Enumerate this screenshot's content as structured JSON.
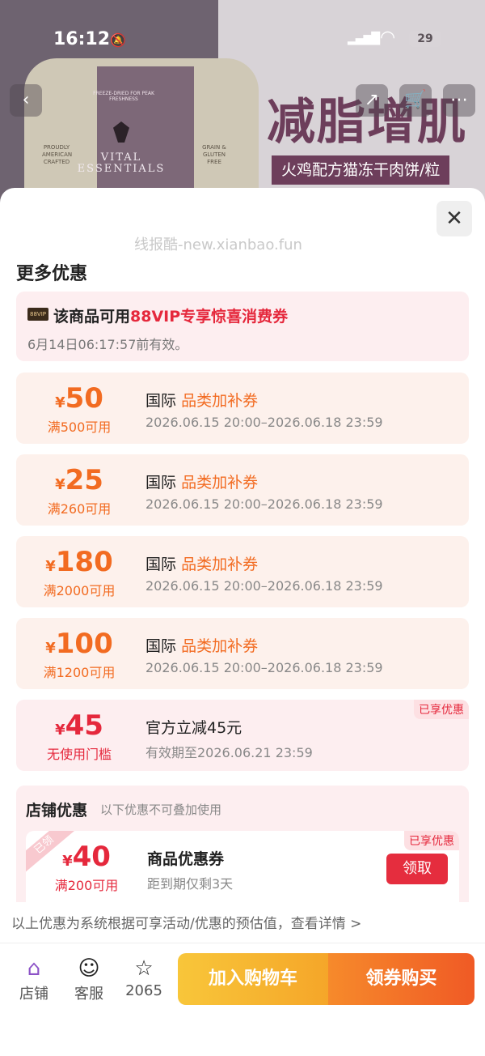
{
  "status": {
    "time": "16:12",
    "battery": "29"
  },
  "product_bg": {
    "promo_title": "减脂增肌",
    "promo_sub": "火鸡配方猫冻干肉饼/粒",
    "brand": "VITAL ESSENTIALS",
    "tagline": "FREEZE-DRIED FOR PEAK FRESHNESS",
    "badge_left": "PROUDLY AMERICAN CRAFTED",
    "badge_right": "GRAIN & GLUTEN FREE"
  },
  "sheet": {
    "watermark": "线报酷-new.xianbao.fun",
    "title": "更多优惠",
    "vip": {
      "badge": "88VIP",
      "prefix": "该商品可用",
      "highlight": "88VIP专享惊喜消费券",
      "validity": "6月14日06:17:57前有效。"
    },
    "coupons": [
      {
        "yen": "¥",
        "amount": "50",
        "cond": "满500可用",
        "title_prefix": "国际",
        "title_hl": "品类加补券",
        "date": "2026.06.15 20:00–2026.06.18 23:59"
      },
      {
        "yen": "¥",
        "amount": "25",
        "cond": "满260可用",
        "title_prefix": "国际",
        "title_hl": "品类加补券",
        "date": "2026.06.15 20:00–2026.06.18 23:59"
      },
      {
        "yen": "¥",
        "amount": "180",
        "cond": "满2000可用",
        "title_prefix": "国际",
        "title_hl": "品类加补券",
        "date": "2026.06.15 20:00–2026.06.18 23:59"
      },
      {
        "yen": "¥",
        "amount": "100",
        "cond": "满1200可用",
        "title_prefix": "国际",
        "title_hl": "品类加补券",
        "date": "2026.06.15 20:00–2026.06.18 23:59"
      },
      {
        "yen": "¥",
        "amount": "45",
        "cond": "无使用门槛",
        "title_prefix": "官方立减45元",
        "title_hl": "",
        "date": "有效期至2026.06.21 23:59",
        "tag": "已享优惠"
      }
    ],
    "store": {
      "title": "店铺优惠",
      "note": "以下优惠不可叠加使用",
      "coupon": {
        "ribbon": "已领",
        "yen": "¥",
        "amount": "40",
        "cond": "满200可用",
        "title": "商品优惠券",
        "sub": "距到期仅剩3天",
        "tag": "已享优惠",
        "button": "领取"
      }
    },
    "footnote": "以上优惠为系统根据可享活动/优惠的预估值，查看详情 >"
  },
  "bottom_bar": {
    "store_label": "店铺",
    "service_label": "客服",
    "fav_count": "2065",
    "cart_label": "加入购物车",
    "buy_label": "领券购买"
  },
  "colors": {
    "orange": "#f26b21",
    "red": "#e5283c",
    "purple": "#8c52c7"
  }
}
